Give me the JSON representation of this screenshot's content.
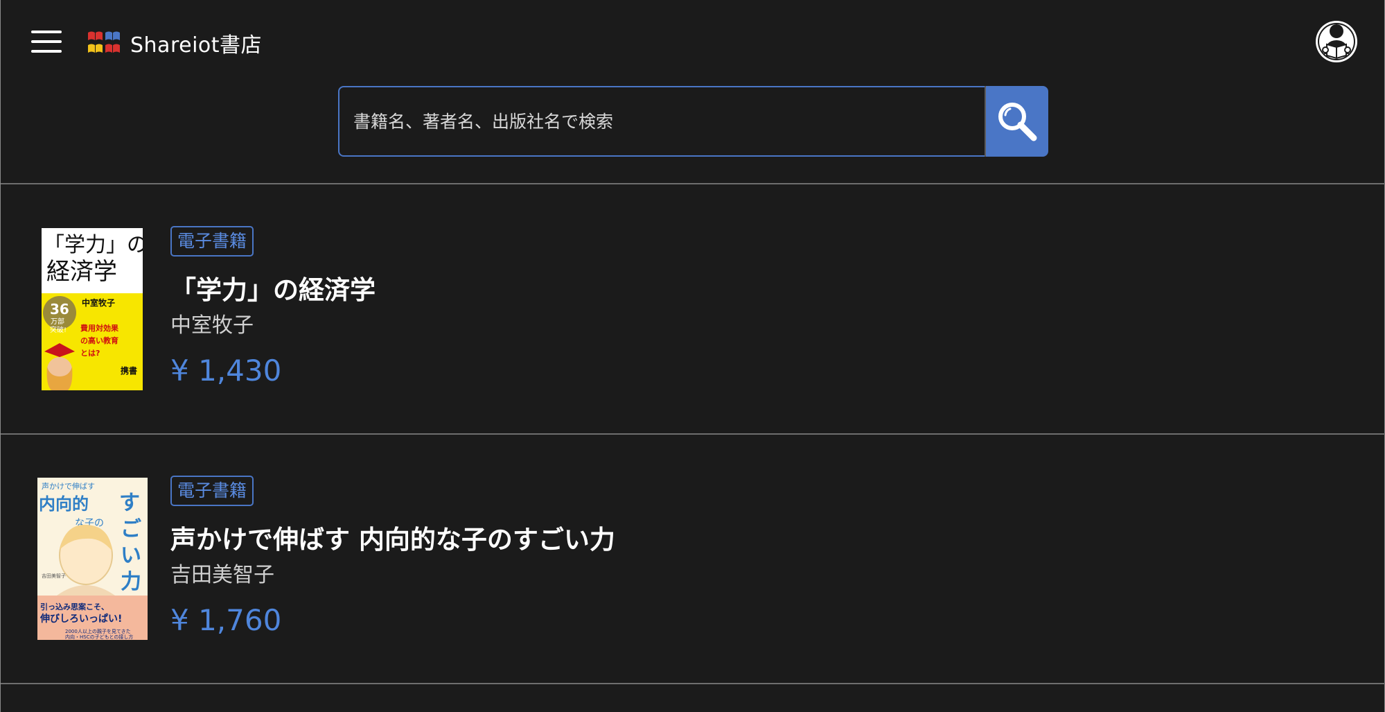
{
  "header": {
    "logo_text": "Shareiot書店",
    "menu_icon": "hamburger-menu-icon",
    "avatar_icon": "reader-avatar-icon"
  },
  "search": {
    "placeholder": "書籍名、著者名、出版社名で検索",
    "value": "",
    "button_icon": "search-icon"
  },
  "colors": {
    "background": "#1b1b1b",
    "accent": "#4a76c6",
    "price": "#4f86dc"
  },
  "books": [
    {
      "badge": "電子書籍",
      "title": "「学力」の経済学",
      "author": "中室牧子",
      "price": "¥ 1,430",
      "cover": {
        "title_top": "「学力」の",
        "title_bottom": "経済学",
        "author": "中室牧子",
        "sales": "36",
        "sales_unit": "万部",
        "sales_suffix": "突破!",
        "headline": "費用対効果の高い教育とは?",
        "label": "携書"
      }
    },
    {
      "badge": "電子書籍",
      "title": "声かけで伸ばす 内向的な子のすごい力",
      "author": "吉田美智子",
      "price": "¥ 1,760",
      "cover": {
        "top_line": "声かけで伸ばす",
        "title_a": "内向的",
        "title_b": "な子の",
        "title_c": "すごい力",
        "tagline": "引っ込み思案こそ、伸びしろいっぱい!",
        "author": "吉田美智子"
      }
    }
  ]
}
